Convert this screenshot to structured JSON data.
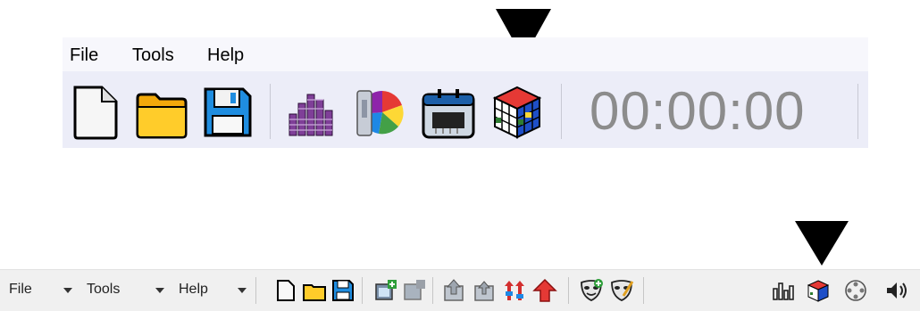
{
  "top": {
    "menu": [
      "File",
      "Tools",
      "Help"
    ],
    "time": "00:00:00",
    "icons": [
      "new-file-icon",
      "open-folder-icon",
      "save-disk-icon",
      "equalizer-bars-icon",
      "color-wheel-icon",
      "memory-chip-icon",
      "rubiks-cube-icon"
    ]
  },
  "bottom": {
    "menu": [
      "File",
      "Tools",
      "Help"
    ],
    "icons": [
      "new-file-icon",
      "open-folder-icon",
      "save-disk-icon",
      "add-window-icon",
      "remove-window-icon",
      "move-up-icon",
      "move-down-icon",
      "frequency-icon",
      "red-up-arrow-icon",
      "add-mask-icon",
      "edit-mask-icon",
      "bar-chart-icon",
      "rubiks-cube-icon",
      "film-reel-icon",
      "speaker-icon"
    ]
  },
  "colors": {
    "arrow": "#000000",
    "time": "#8c8c8c",
    "panel": "#ecedf8"
  }
}
